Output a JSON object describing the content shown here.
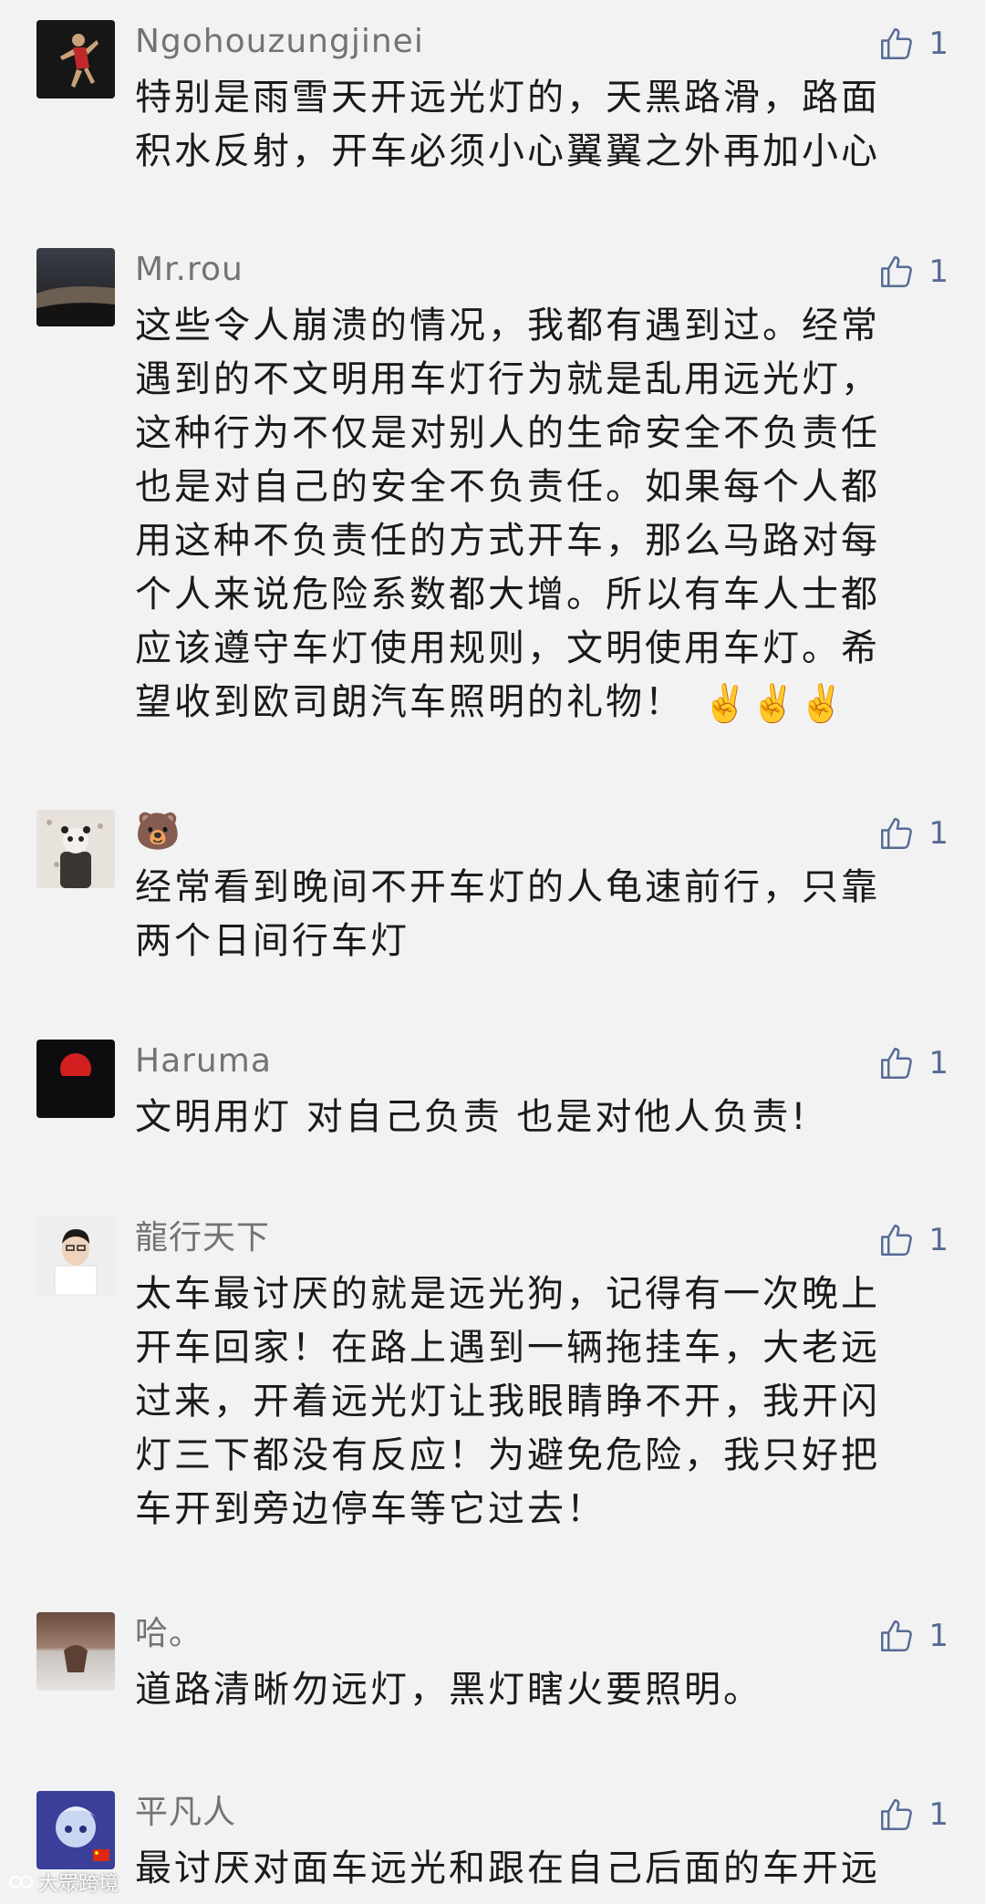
{
  "comments": [
    {
      "nickname": "Ngohouzungjinei",
      "likes": "1",
      "lines": [
        "特别是雨雪天开远光灯的，天黑路滑，路面",
        "积水反射，开车必须小心翼翼之外再加小心"
      ]
    },
    {
      "nickname": "Mr.rou",
      "likes": "1",
      "lines": [
        "这些令人崩溃的情况，我都有遇到过。经常",
        "遇到的不文明用车灯行为就是乱用远光灯，",
        "这种行为不仅是对别人的生命安全不负责任",
        "也是对自己的安全不负责任。如果每个人都",
        "用这种不负责任的方式开车，那么马路对每",
        "个人来说危险系数都大增。所以有车人士都",
        "应该遵守车灯使用规则，文明使用车灯。希",
        "望收到欧司朗汽车照明的礼物！"
      ],
      "trailing_emoji": "✌️✌️✌️"
    },
    {
      "nickname": "🐻",
      "likes": "1",
      "lines": [
        "经常看到晚间不开车灯的人龟速前行，只靠",
        "两个日间行车灯"
      ]
    },
    {
      "nickname": "Haruma",
      "likes": "1",
      "lines": [
        "文明用灯 对自己负责 也是对他人负责!"
      ]
    },
    {
      "nickname": "龍行天下",
      "likes": "1",
      "lines": [
        "太车最讨厌的就是远光狗，记得有一次晚上",
        "开车回家！在路上遇到一辆拖挂车，大老远",
        "过来，开着远光灯让我眼睛睁不开，我开闪",
        "灯三下都没有反应！为避免危险，我只好把",
        "车开到旁边停车等它过去！"
      ]
    },
    {
      "nickname": "哈。",
      "likes": "1",
      "lines": [
        "道路清晰勿远灯，黑灯瞎火要照明。"
      ]
    },
    {
      "nickname": "平凡人",
      "likes": "1",
      "lines": [
        "最讨厌对面车远光和跟在自己后面的车开远"
      ]
    }
  ],
  "watermark": "大眾跨境",
  "colors": {
    "background": "#f2f2f2",
    "nickname": "#737373",
    "content": "#1a1a1a",
    "like": "#576b95"
  }
}
